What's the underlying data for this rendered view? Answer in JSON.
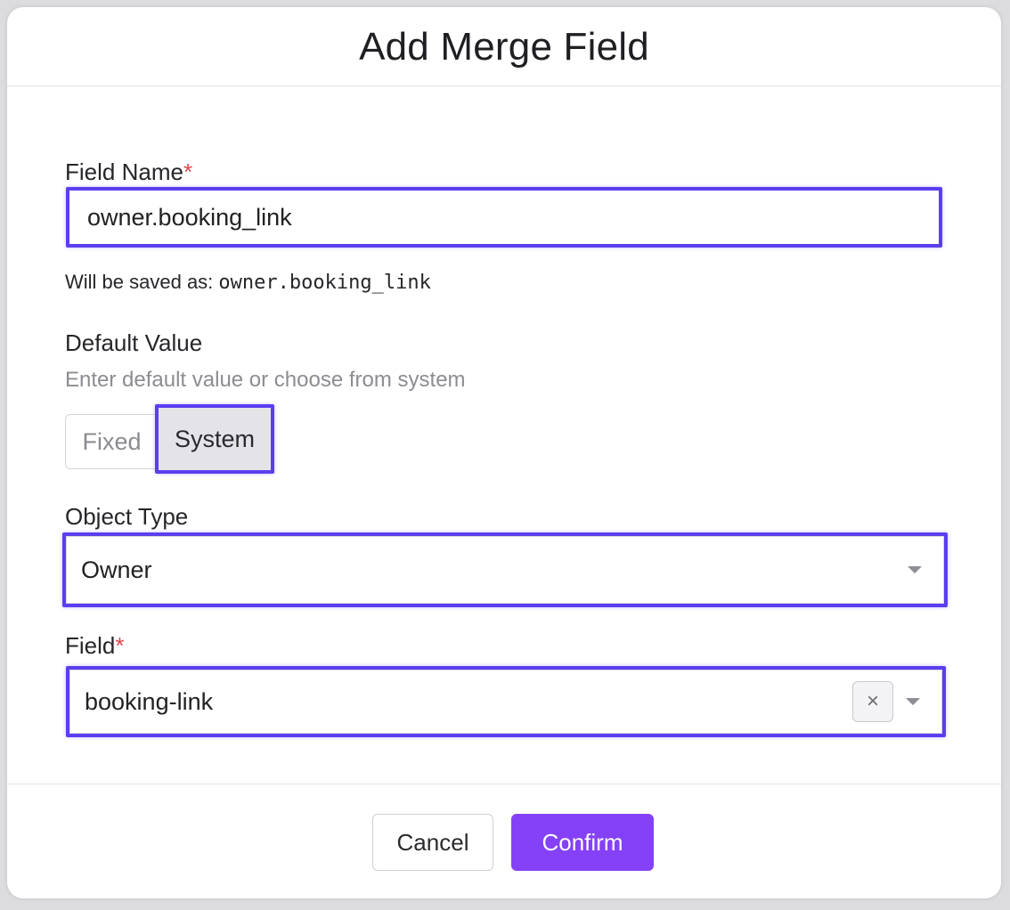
{
  "dialog": {
    "title": "Add Merge Field"
  },
  "field_name": {
    "label": "Field Name",
    "required_mark": "*",
    "value": "owner.booking_link",
    "saved_as_prefix": "Will be saved as:",
    "saved_as_value": "owner.booking_link"
  },
  "default_value": {
    "label": "Default Value",
    "helper": "Enter default value or choose from system",
    "options": [
      "Fixed",
      "System"
    ],
    "selected": "System"
  },
  "object_type": {
    "label": "Object Type",
    "value": "Owner"
  },
  "field": {
    "label": "Field",
    "required_mark": "*",
    "value": "booking-link",
    "clear_glyph": "×"
  },
  "footer": {
    "cancel_label": "Cancel",
    "confirm_label": "Confirm"
  },
  "colors": {
    "highlight": "#5b3ef0",
    "confirm": "#8541f7",
    "required": "#e0474c"
  }
}
